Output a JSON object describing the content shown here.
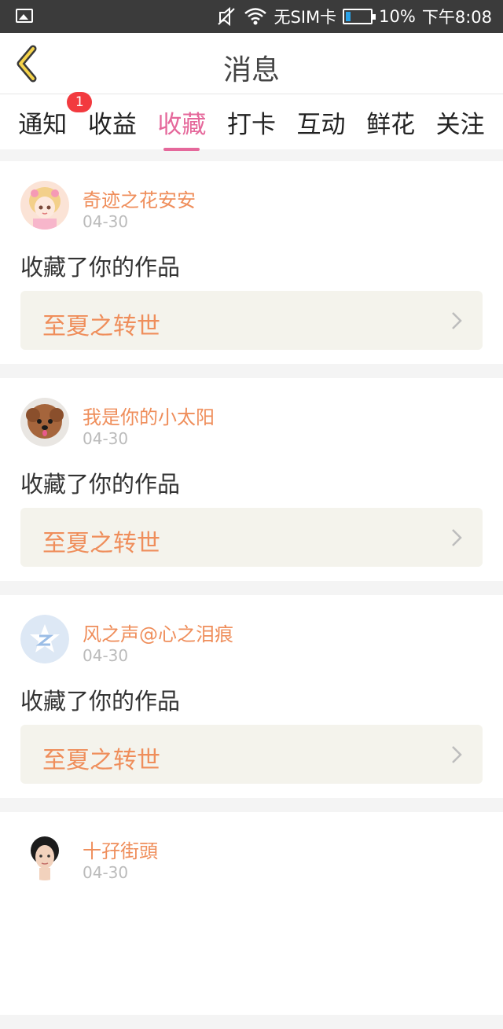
{
  "status_bar": {
    "sim_text": "无SIM卡",
    "battery_percent": "10%",
    "time": "下午8:08",
    "battery_level": 0.1
  },
  "header": {
    "title": "消息"
  },
  "tabs": [
    {
      "label": "通知",
      "badge": "1",
      "active": false
    },
    {
      "label": "收益",
      "active": false
    },
    {
      "label": "收藏",
      "active": true
    },
    {
      "label": "打卡",
      "active": false
    },
    {
      "label": "互动",
      "active": false
    },
    {
      "label": "鲜花",
      "active": false
    },
    {
      "label": "关注",
      "active": false
    }
  ],
  "messages": [
    {
      "user": "奇迹之花安安",
      "date": "04-30",
      "action": "收藏了你的作品",
      "work": "至夏之转世",
      "avatar_icon": "anime-girl-avatar"
    },
    {
      "user": "我是你的小太阳",
      "date": "04-30",
      "action": "收藏了你的作品",
      "work": "至夏之转世",
      "avatar_icon": "puppy-avatar"
    },
    {
      "user": "风之声@心之泪痕",
      "date": "04-30",
      "action": "收藏了你的作品",
      "work": "至夏之转世",
      "avatar_icon": "default-z-avatar"
    },
    {
      "user": "十孖街頭",
      "date": "04-30",
      "avatar_icon": "woman-avatar"
    }
  ],
  "colors": {
    "accent": "#e5689b",
    "name_color": "#ef8e5b",
    "badge": "#f23a3f"
  }
}
